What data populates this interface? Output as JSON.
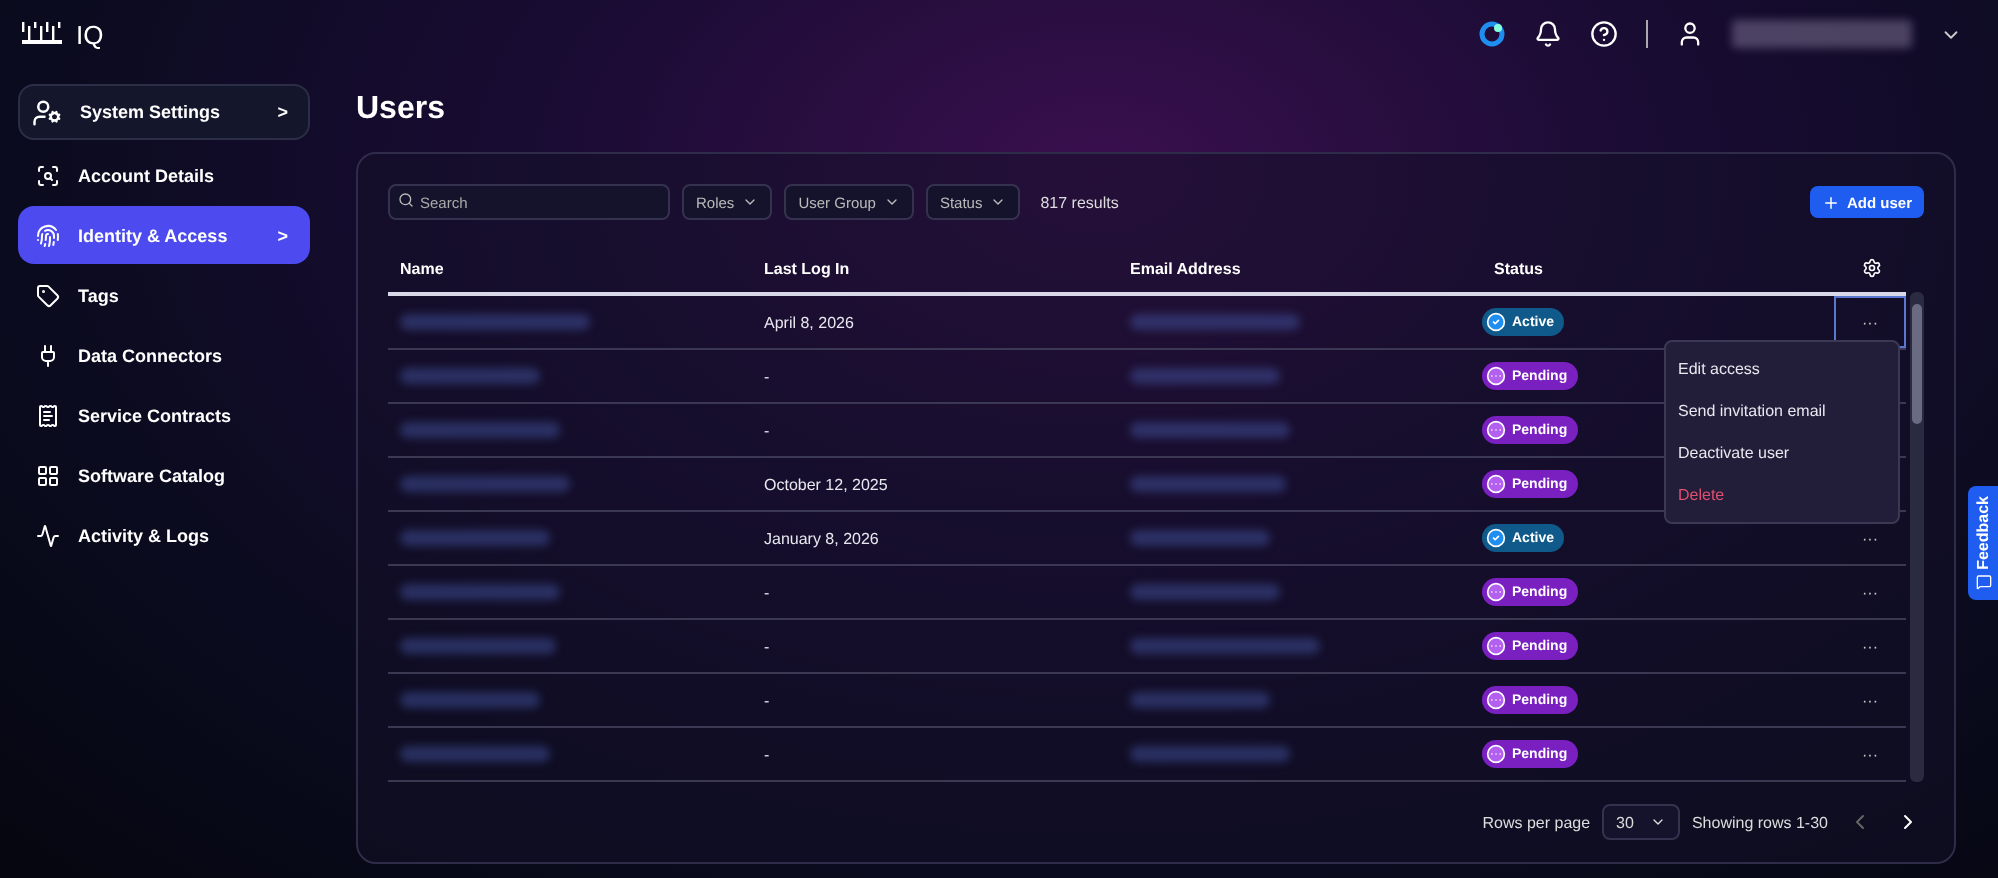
{
  "brand": {
    "product": "IQ"
  },
  "sidebar": {
    "items": [
      {
        "label": "System Settings",
        "kind": "header",
        "selected": false,
        "chevron": ">"
      },
      {
        "label": "Account Details",
        "kind": "item",
        "selected": false
      },
      {
        "label": "Identity & Access",
        "kind": "item",
        "selected": true,
        "chevron": ">"
      },
      {
        "label": "Tags",
        "kind": "item",
        "selected": false
      },
      {
        "label": "Data Connectors",
        "kind": "item",
        "selected": false
      },
      {
        "label": "Service Contracts",
        "kind": "item",
        "selected": false
      },
      {
        "label": "Software Catalog",
        "kind": "item",
        "selected": false
      },
      {
        "label": "Activity & Logs",
        "kind": "item",
        "selected": false
      }
    ]
  },
  "page": {
    "title": "Users"
  },
  "toolbar": {
    "search": {
      "placeholder": "Search"
    },
    "filters": [
      "Roles",
      "User Group",
      "Status"
    ],
    "results": "817 results",
    "add_button": "Add user"
  },
  "table": {
    "columns": [
      "Name",
      "Last Log In",
      "Email Address",
      "Status"
    ],
    "rows": [
      {
        "last_log_in": "April 8, 2026",
        "status": "Active",
        "kind": "active",
        "actions": "···",
        "menu_open": true
      },
      {
        "last_log_in": "-",
        "status": "Pending",
        "kind": "pending",
        "menu_open": false
      },
      {
        "last_log_in": "-",
        "status": "Pending",
        "kind": "pending",
        "menu_open": false
      },
      {
        "last_log_in": "October 12, 2025",
        "status": "Pending",
        "kind": "pending",
        "menu_open": false
      },
      {
        "last_log_in": "January 8, 2026",
        "status": "Active",
        "kind": "active",
        "actions": "···",
        "menu_open": false
      },
      {
        "last_log_in": "-",
        "status": "Pending",
        "kind": "pending",
        "actions": "···",
        "menu_open": false
      },
      {
        "last_log_in": "-",
        "status": "Pending",
        "kind": "pending",
        "actions": "···",
        "menu_open": false
      },
      {
        "last_log_in": "-",
        "status": "Pending",
        "kind": "pending",
        "actions": "···",
        "menu_open": false
      },
      {
        "last_log_in": "-",
        "status": "Pending",
        "kind": "pending",
        "actions": "···",
        "menu_open": false
      }
    ]
  },
  "row_menu": {
    "items": [
      {
        "label": "Edit access",
        "kind": "normal"
      },
      {
        "label": "Send invitation email",
        "kind": "normal"
      },
      {
        "label": "Deactivate user",
        "kind": "normal"
      },
      {
        "label": "Delete",
        "kind": "danger"
      }
    ]
  },
  "pagination": {
    "rows_per_page_label": "Rows per page",
    "rows_per_page": "30",
    "range": "Showing rows 1-30"
  },
  "feedback": {
    "label": "Feedback"
  }
}
